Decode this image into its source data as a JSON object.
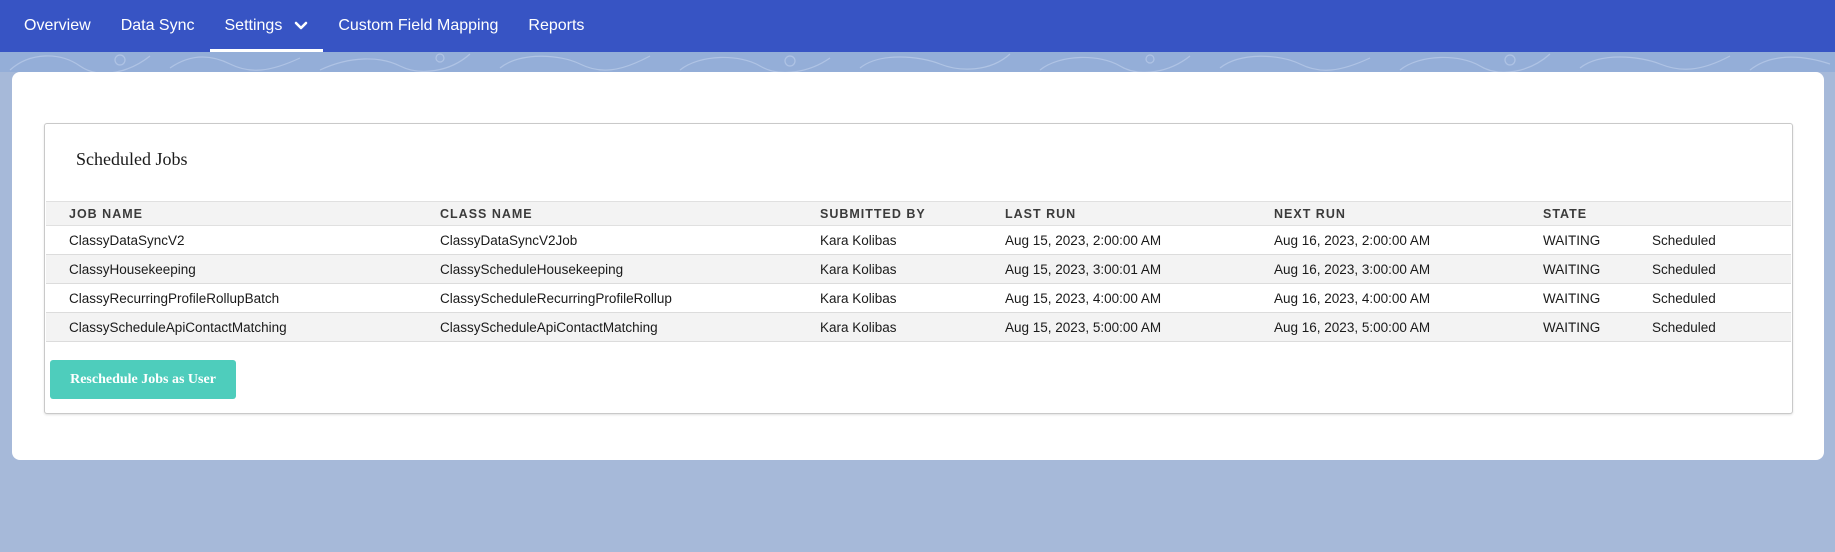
{
  "nav": {
    "items": [
      {
        "label": "Overview"
      },
      {
        "label": "Data Sync"
      },
      {
        "label": "Settings"
      },
      {
        "label": "Custom Field Mapping"
      },
      {
        "label": "Reports"
      }
    ],
    "active_index": 2
  },
  "panel": {
    "title": "Scheduled Jobs",
    "columns": [
      "JOB NAME",
      "CLASS NAME",
      "SUBMITTED BY",
      "LAST RUN",
      "NEXT RUN",
      "STATE",
      ""
    ],
    "rows": [
      [
        "ClassyDataSyncV2",
        "ClassyDataSyncV2Job",
        "Kara Kolibas",
        "Aug 15, 2023, 2:00:00 AM",
        "Aug 16, 2023, 2:00:00 AM",
        "WAITING",
        "Scheduled"
      ],
      [
        "ClassyHousekeeping",
        "ClassyScheduleHousekeeping",
        "Kara Kolibas",
        "Aug 15, 2023, 3:00:01 AM",
        "Aug 16, 2023, 3:00:00 AM",
        "WAITING",
        "Scheduled"
      ],
      [
        "ClassyRecurringProfileRollupBatch",
        "ClassyScheduleRecurringProfileRollup",
        "Kara Kolibas",
        "Aug 15, 2023, 4:00:00 AM",
        "Aug 16, 2023, 4:00:00 AM",
        "WAITING",
        "Scheduled"
      ],
      [
        "ClassyScheduleApiContactMatching",
        "ClassyScheduleApiContactMatching",
        "Kara Kolibas",
        "Aug 15, 2023, 5:00:00 AM",
        "Aug 16, 2023, 5:00:00 AM",
        "WAITING",
        "Scheduled"
      ]
    ],
    "button_label": "Reschedule Jobs as User"
  },
  "colors": {
    "nav_bg": "#3754c4",
    "page_bg": "#a6b9d9",
    "button_bg": "#4ecdbc"
  },
  "icons": {
    "settings_dropdown": "chevron-down-icon"
  }
}
